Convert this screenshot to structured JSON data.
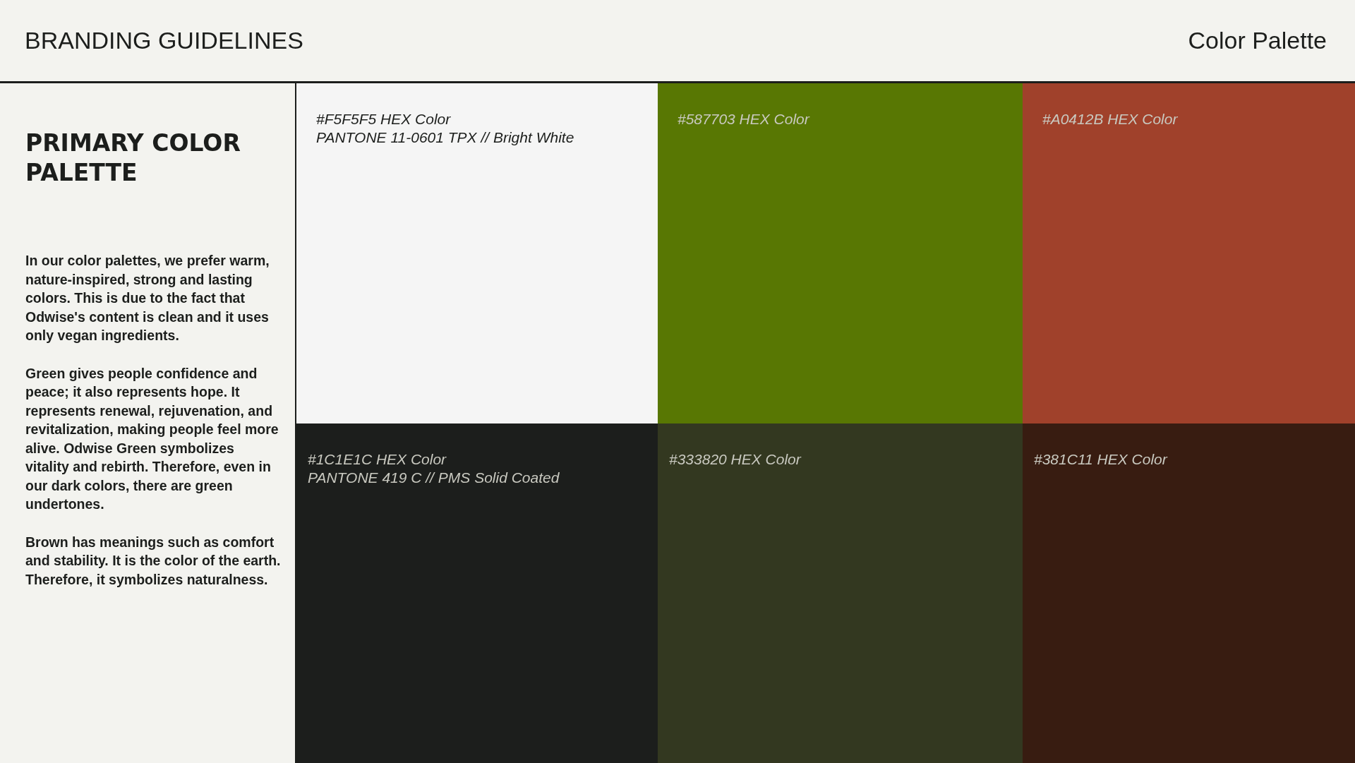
{
  "header": {
    "title": "BRANDING GUIDELINES",
    "section": "Color Palette"
  },
  "sidebar": {
    "heading": "PRIMARY COLOR PALETTE",
    "paragraphs": [
      "In our color palettes, we prefer warm, nature-inspired, strong and lasting colors. This is due to the fact that Odwise's content is clean and it uses only vegan ingredients.",
      "Green gives people confidence and peace; it also represents hope. It represents renewal, rejuvenation, and revitalization, making people feel more alive. Odwise Green symbolizes vitality and rebirth. Therefore, even in our dark colors, there are green undertones.",
      "Brown has meanings such as comfort and stability. It is the color of the earth. Therefore, it symbolizes naturalness."
    ]
  },
  "swatches": [
    {
      "color": "#f5f5f5",
      "lines": [
        "#F5F5F5 HEX Color",
        "PANTONE 11-0601 TPX // Bright White"
      ]
    },
    {
      "color": "#587703",
      "lines": [
        "#587703 HEX Color"
      ]
    },
    {
      "color": "#a0412b",
      "lines": [
        "#A0412B HEX Color"
      ]
    },
    {
      "color": "#1c1e1c",
      "lines": [
        "#1C1E1C HEX Color",
        "PANTONE 419 C // PMS Solid Coated"
      ]
    },
    {
      "color": "#333820",
      "lines": [
        "#333820 HEX Color"
      ]
    },
    {
      "color": "#381c11",
      "lines": [
        "#381C11 HEX Color"
      ]
    }
  ]
}
